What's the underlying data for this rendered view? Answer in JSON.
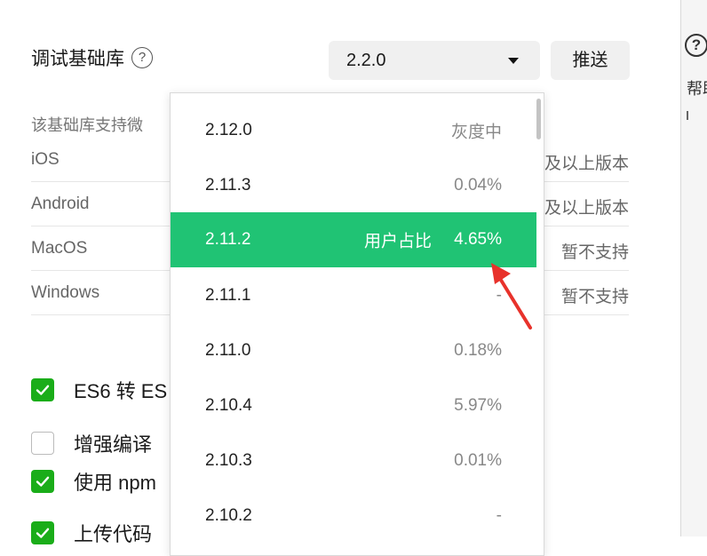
{
  "settings": {
    "label": "调试基础库",
    "help_icon": "question-circle-icon",
    "selected_version": "2.2.0",
    "push_label": "推送",
    "support_desc": "该基础库支持微",
    "platforms": [
      {
        "name": "iOS",
        "value": "及以上版本"
      },
      {
        "name": "Android",
        "value": "及以上版本"
      },
      {
        "name": "MacOS",
        "value": "暂不支持"
      },
      {
        "name": "Windows",
        "value": "暂不支持"
      }
    ],
    "extra_dash": "-"
  },
  "options": [
    {
      "label": "ES6 转 ES",
      "checked": true
    },
    {
      "label": "增强编译",
      "checked": false
    },
    {
      "label": "使用 npm",
      "checked": true
    },
    {
      "label": "上传代码",
      "checked": true
    }
  ],
  "dropdown": {
    "items": [
      {
        "version": "2.12.0",
        "share": "灰度中"
      },
      {
        "version": "2.11.3",
        "share": "0.04%"
      },
      {
        "version": "2.11.2",
        "share": "4.65%",
        "user_label": "用户占比",
        "selected": true
      },
      {
        "version": "2.11.1",
        "share": "-"
      },
      {
        "version": "2.11.0",
        "share": "0.18%"
      },
      {
        "version": "2.10.4",
        "share": "5.97%"
      },
      {
        "version": "2.10.3",
        "share": "0.01%"
      },
      {
        "version": "2.10.2",
        "share": "-"
      }
    ]
  },
  "right_panel": {
    "icon": "question-circle-icon",
    "text": "帮助"
  },
  "colors": {
    "accent_green": "#20c374",
    "checkbox_green": "#1aad19",
    "annotation_red": "#e8322b"
  }
}
